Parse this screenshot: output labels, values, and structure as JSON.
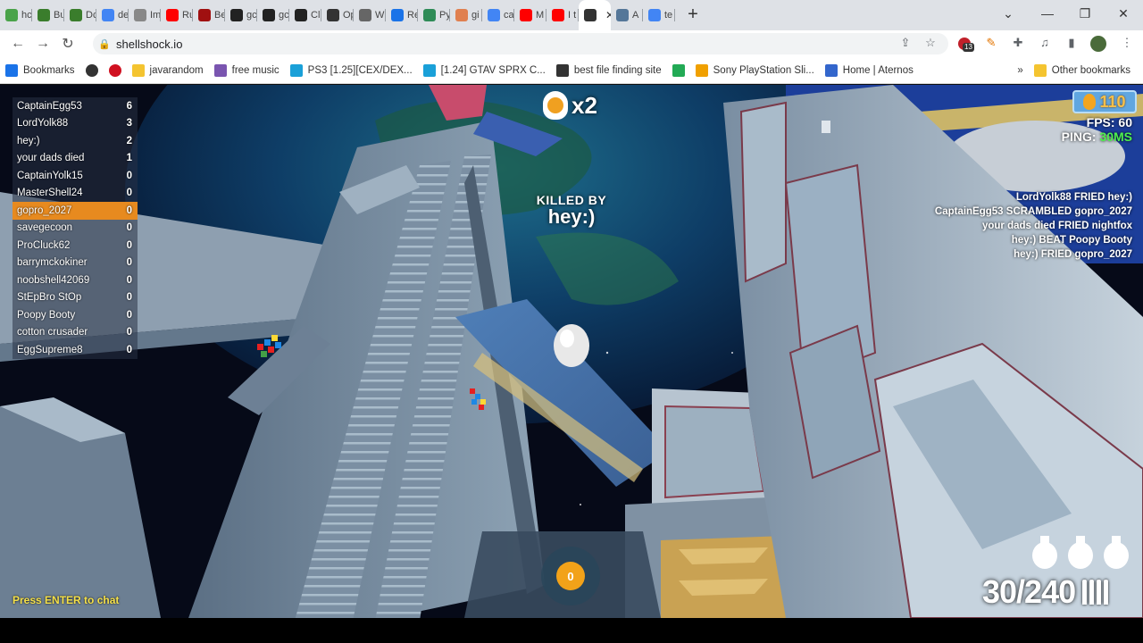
{
  "browser": {
    "tabs": [
      {
        "label": "hc",
        "icon": "multicolor-icon",
        "color": "#4aa34a"
      },
      {
        "label": "Bu",
        "icon": "creeper-icon",
        "color": "#3a7d2c"
      },
      {
        "label": "Dc",
        "icon": "creeper-icon",
        "color": "#3a7d2c"
      },
      {
        "label": "de",
        "icon": "google-icon",
        "color": "#4285f4"
      },
      {
        "label": "Im",
        "icon": "chart-icon",
        "color": "#888888"
      },
      {
        "label": "Ru",
        "icon": "youtube-icon",
        "color": "#ff0000"
      },
      {
        "label": "Be",
        "icon": "m-icon",
        "color": "#a01010"
      },
      {
        "label": "gc",
        "icon": "github-icon",
        "color": "#222222"
      },
      {
        "label": "gc",
        "icon": "github-icon",
        "color": "#222222"
      },
      {
        "label": "Cl",
        "icon": "github-icon",
        "color": "#222222"
      },
      {
        "label": "Op",
        "icon": "openai-icon",
        "color": "#333333"
      },
      {
        "label": "W",
        "icon": "globe-icon",
        "color": "#666666"
      },
      {
        "label": "Re",
        "icon": "blue-dot-icon",
        "color": "#1a73e8"
      },
      {
        "label": "Py",
        "icon": "w-icon",
        "color": "#2e8b57"
      },
      {
        "label": "gi",
        "icon": "hand-icon",
        "color": "#e08050"
      },
      {
        "label": "ca",
        "icon": "google-icon",
        "color": "#4285f4"
      },
      {
        "label": "M",
        "icon": "youtube-icon",
        "color": "#ff0000"
      },
      {
        "label": "I t",
        "icon": "youtube-icon",
        "color": "#ff0000"
      },
      {
        "label": "",
        "icon": "speaker-icon",
        "color": "#333333",
        "active": true
      },
      {
        "label": "A",
        "icon": "image-icon",
        "color": "#557799"
      },
      {
        "label": "te",
        "icon": "google-icon",
        "color": "#4285f4"
      }
    ],
    "new_tab": "+",
    "window_controls": {
      "dropdown": "⌄",
      "minimize": "—",
      "restore": "❐",
      "close": "✕"
    },
    "nav": {
      "back": "←",
      "forward": "→",
      "reload": "↻"
    },
    "url": "shellshock.io",
    "extension_badge": "13",
    "bookmarks": [
      {
        "label": "Bookmarks",
        "icon": "star-icon",
        "color": "#1a73e8"
      },
      {
        "label": "",
        "icon": "globe-icon",
        "color": "#333333"
      },
      {
        "label": "",
        "icon": "heart-icon",
        "color": "#d01020"
      },
      {
        "label": "javarandom",
        "icon": "folder-icon",
        "color": "#f4c430"
      },
      {
        "label": "free music",
        "icon": "parachute-icon",
        "color": "#7a55b0"
      },
      {
        "label": "PS3 [1.25][CEX/DEX...",
        "icon": "c-icon",
        "color": "#1aa0d8"
      },
      {
        "label": "[1.24] GTAV SPRX C...",
        "icon": "c-icon",
        "color": "#1aa0d8"
      },
      {
        "label": "best file finding site",
        "icon": "robot-icon",
        "color": "#333333"
      },
      {
        "label": "",
        "icon": "green-square-icon",
        "color": "#22aa55"
      },
      {
        "label": "Sony PlayStation Sli...",
        "icon": "bag-icon",
        "color": "#f0a000"
      },
      {
        "label": "Home | Aternos",
        "icon": "grid-icon",
        "color": "#3366cc"
      }
    ],
    "bookmarks_more": "»",
    "other_bookmarks": "Other bookmarks"
  },
  "game": {
    "scoreboard": [
      {
        "name": "CaptainEgg53",
        "score": "6"
      },
      {
        "name": "LordYolk88",
        "score": "3"
      },
      {
        "name": "hey:)",
        "score": "2"
      },
      {
        "name": "your dads died",
        "score": "1"
      },
      {
        "name": "CaptainYolk15",
        "score": "0"
      },
      {
        "name": "MasterShell24",
        "score": "0"
      },
      {
        "name": "gopro_2027",
        "score": "0",
        "me": true
      },
      {
        "name": "savegecoon",
        "score": "0"
      },
      {
        "name": "ProCluck62",
        "score": "0"
      },
      {
        "name": "barrymckokiner",
        "score": "0"
      },
      {
        "name": "noobshell42069",
        "score": "0"
      },
      {
        "name": "StEpBro StOp",
        "score": "0"
      },
      {
        "name": "Poopy Booty",
        "score": "0"
      },
      {
        "name": "cotton crusader",
        "score": "0"
      },
      {
        "name": "EggSupreme8",
        "score": "0"
      }
    ],
    "kill_multiplier": "x2",
    "killed_by_label": "KILLED BY",
    "killer": "hey:)",
    "eggs": "110",
    "fps_label": "FPS: 60",
    "ping_label": "PING: ",
    "ping_value": "30MS",
    "killfeed": [
      "LordYolk88 FRIED hey:)",
      "CaptainEgg53 SCRAMBLED gopro_2027",
      "your dads died FRIED nightfox",
      "hey:) BEAT Poopy Booty",
      "hey:) FRIED gopro_2027"
    ],
    "chat_hint": "Press ENTER to chat",
    "grenade_timer": "0",
    "grenade_count": 3,
    "ammo": "30/240",
    "colors": {
      "accent": "#e78a1f",
      "ping": "#4ef04e",
      "egg": "#f3a520",
      "chat": "#f5e14a"
    }
  }
}
